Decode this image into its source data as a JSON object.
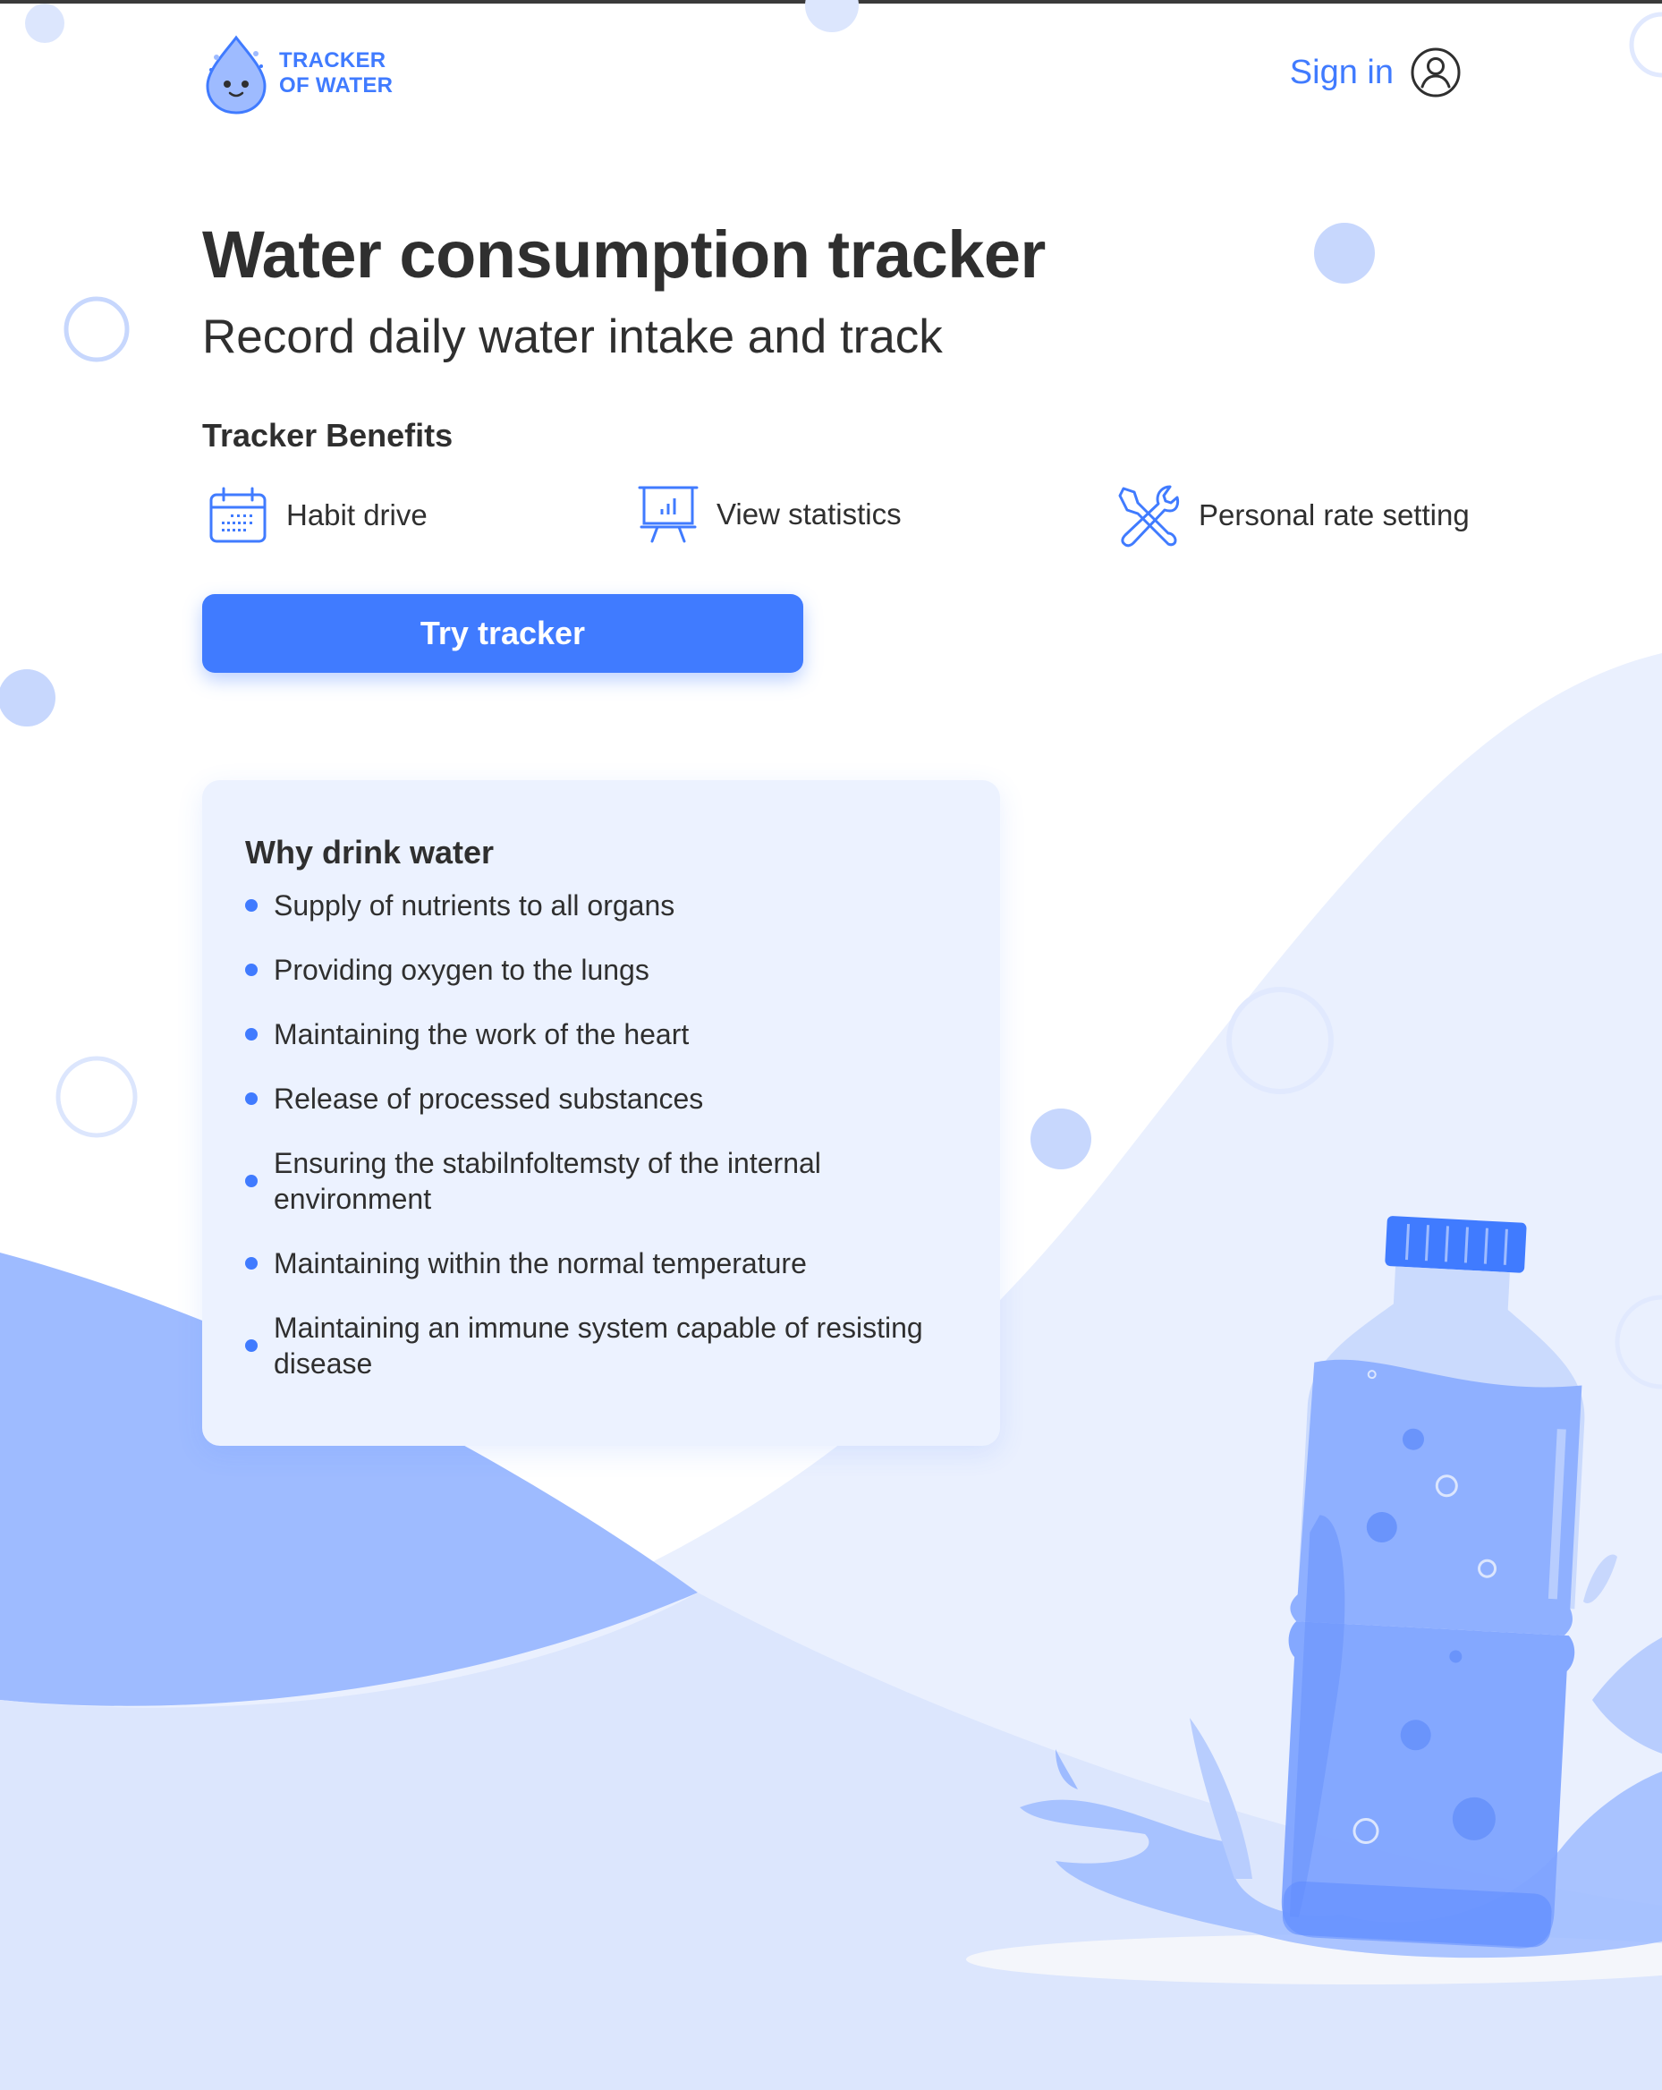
{
  "app": {
    "logo_line1": "TRACKER",
    "logo_line2": "OF WATER"
  },
  "header": {
    "signin_label": "Sign in",
    "signin_icon": "user-circle-icon"
  },
  "hero": {
    "title": "Water consumption tracker",
    "subtitle": "Record daily water intake and track"
  },
  "benefits": {
    "title": "Tracker Benefits",
    "items": [
      {
        "label": "Habit drive",
        "icon": "calendar-icon"
      },
      {
        "label": "View statistics",
        "icon": "chart-presentation-icon"
      },
      {
        "label": "Personal rate setting",
        "icon": "tools-icon"
      }
    ]
  },
  "cta": {
    "label": "Try tracker"
  },
  "why": {
    "title": "Why drink water",
    "items": [
      "Supply of nutrients to all organs",
      "Providing oxygen to the lungs",
      "Maintaining the work of the heart",
      "Release of processed substances",
      "Ensuring the stabilnfoltemsty of the internal environment",
      "Maintaining within the normal temperature",
      "Maintaining an immune system capable of resisting disease"
    ]
  },
  "colors": {
    "accent": "#407bff",
    "text": "#2f2f2f",
    "card_bg": "#ecf2ff",
    "wave_light": "#dce6fd",
    "wave_mid": "#9ebbff"
  }
}
